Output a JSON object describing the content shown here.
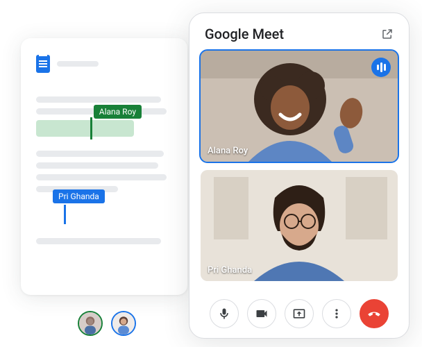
{
  "doc": {
    "cursor_labels": {
      "alana": "Alana Roy",
      "pri": "Pri Ghanda"
    }
  },
  "avatars": {
    "alana": "Alana Roy",
    "pri": "Pri Ghanda"
  },
  "meet": {
    "title": "Google Meet",
    "participants": [
      {
        "name": "Alana Roy",
        "speaking": true
      },
      {
        "name": "Pri Ghanda",
        "speaking": false
      }
    ],
    "controls": {
      "mic": "microphone",
      "camera": "camera",
      "present": "present-screen",
      "more": "more-options",
      "hangup": "hang-up"
    }
  }
}
